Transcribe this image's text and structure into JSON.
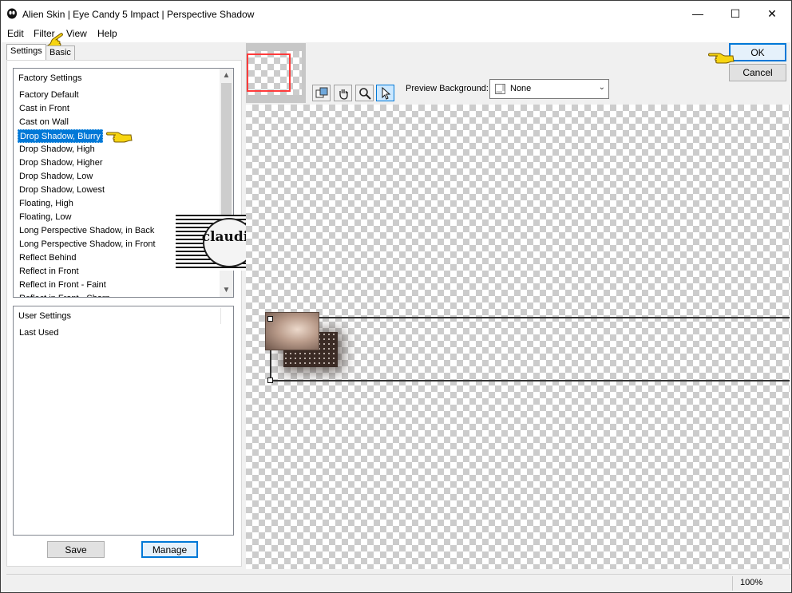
{
  "window": {
    "title": "Alien Skin | Eye Candy 5 Impact | Perspective Shadow",
    "minimize_glyph": "—",
    "maximize_glyph": "☐",
    "close_glyph": "✕"
  },
  "menu": {
    "edit": "Edit",
    "filter": "Filter",
    "view": "View",
    "help": "Help"
  },
  "tabs": {
    "settings": "Settings",
    "basic": "Basic"
  },
  "factory_settings": {
    "header": "Factory Settings",
    "items": [
      "Factory Default",
      "Cast in Front",
      "Cast on Wall",
      "Drop Shadow, Blurry",
      "Drop Shadow, High",
      "Drop Shadow, Higher",
      "Drop Shadow, Low",
      "Drop Shadow, Lowest",
      "Floating, High",
      "Floating, Low",
      "Long Perspective Shadow, in Back",
      "Long Perspective Shadow, in Front",
      "Reflect Behind",
      "Reflect in Front",
      "Reflect in Front - Faint",
      "Reflect in Front - Sharp"
    ],
    "selected_index": 3
  },
  "user_settings": {
    "header": "User Settings",
    "items": [
      "Last Used"
    ]
  },
  "buttons": {
    "save": "Save",
    "manage": "Manage",
    "ok": "OK",
    "cancel": "Cancel"
  },
  "preview_background": {
    "label": "Preview Background:",
    "value": "None"
  },
  "watermark": {
    "text": "claudia"
  },
  "status": {
    "zoom": "100%"
  },
  "colors": {
    "accent": "#0078d7",
    "pointer_hand": "#f7d511",
    "nav_rect": "#ff3b3b"
  }
}
